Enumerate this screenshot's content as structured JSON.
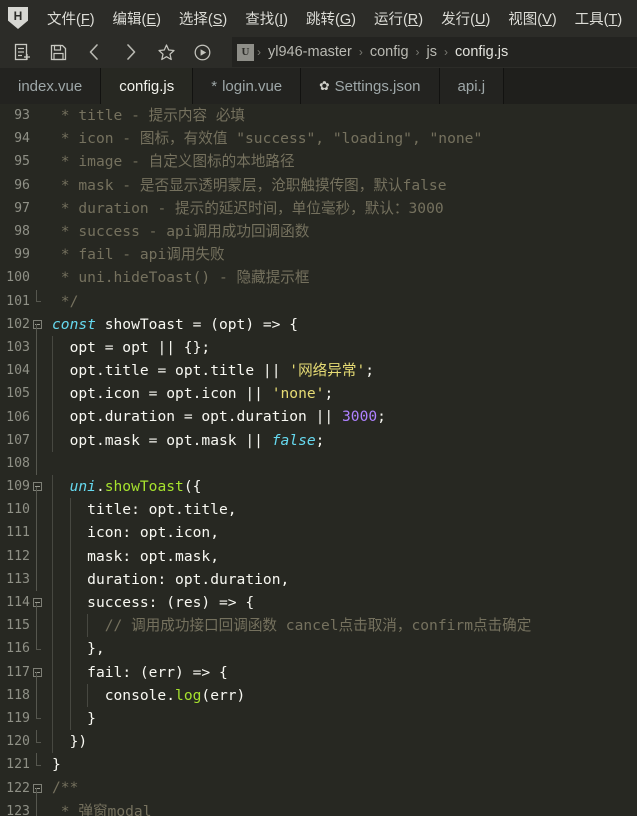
{
  "app": {
    "logo_letter": "H",
    "logo_name": "hbuilder-logo"
  },
  "menubar": {
    "items": [
      {
        "label": "文件(F)",
        "pre": "文件(",
        "key": "F",
        "post": ")"
      },
      {
        "label": "编辑(E)",
        "pre": "编辑(",
        "key": "E",
        "post": ")"
      },
      {
        "label": "选择(S)",
        "pre": "选择(",
        "key": "S",
        "post": ")"
      },
      {
        "label": "查找(I)",
        "pre": "查找(",
        "key": "I",
        "post": ")"
      },
      {
        "label": "跳转(G)",
        "pre": "跳转(",
        "key": "G",
        "post": ")"
      },
      {
        "label": "运行(R)",
        "pre": "运行(",
        "key": "R",
        "post": ")"
      },
      {
        "label": "发行(U)",
        "pre": "发行(",
        "key": "U",
        "post": ")"
      },
      {
        "label": "视图(V)",
        "pre": "视图(",
        "key": "V",
        "post": ")"
      },
      {
        "label": "工具(T)",
        "pre": "工具(",
        "key": "T",
        "post": ")"
      }
    ]
  },
  "toolbar": {
    "icons": [
      {
        "name": "new-file-icon"
      },
      {
        "name": "save-icon"
      },
      {
        "name": "back-arrow-icon"
      },
      {
        "name": "forward-arrow-icon"
      },
      {
        "name": "star-icon"
      },
      {
        "name": "run-icon"
      }
    ],
    "breadcrumb": {
      "project_badge": "U",
      "separator": "›",
      "items": [
        "yl946-master",
        "config",
        "js",
        "config.js"
      ]
    }
  },
  "tabs": [
    {
      "label": "index.vue",
      "active": false,
      "modified": false,
      "gear": false
    },
    {
      "label": "config.js",
      "active": true,
      "modified": false,
      "gear": false
    },
    {
      "label": "login.vue",
      "active": false,
      "modified": true,
      "gear": false,
      "modified_mark": "*"
    },
    {
      "label": "Settings.json",
      "active": false,
      "modified": false,
      "gear": true,
      "gear_glyph": "✿"
    },
    {
      "label": "api.j",
      "active": false,
      "modified": false,
      "gear": false
    }
  ],
  "editor": {
    "first_line": 93,
    "colors": {
      "background": "#272822",
      "foreground": "#f8f8f2",
      "comment": "#75715e",
      "keyword": "#66d9ef",
      "function": "#a6e22e",
      "string": "#e6db74",
      "number": "#ae81ff",
      "linenumber": "#8f9086"
    },
    "lines": [
      {
        "n": 93,
        "fold": "none",
        "guide": 0,
        "text": " * title - 提示内容 必填"
      },
      {
        "n": 94,
        "fold": "none",
        "guide": 0,
        "text": " * icon - 图标，有效值 \"success\", \"loading\", \"none\""
      },
      {
        "n": 95,
        "fold": "none",
        "guide": 0,
        "text": " * image - 自定义图标的本地路径"
      },
      {
        "n": 96,
        "fold": "none",
        "guide": 0,
        "text": " * mask - 是否显示透明蒙层，沧职触摸传图，默认false"
      },
      {
        "n": 97,
        "fold": "none",
        "guide": 0,
        "text": " * duration - 提示的延迟时间，单位毫秒，默认：3000"
      },
      {
        "n": 98,
        "fold": "none",
        "guide": 0,
        "text": " * success - api调用成功回调函数"
      },
      {
        "n": 99,
        "fold": "none",
        "guide": 0,
        "text": " * fail - api调用失败"
      },
      {
        "n": 100,
        "fold": "none",
        "guide": 0,
        "text": " * uni.hideToast() - 隐藏提示框"
      },
      {
        "n": 101,
        "fold": "end",
        "guide": 0,
        "text": " */"
      },
      {
        "n": 102,
        "fold": "start",
        "guide": 0,
        "text": "const showToast = (opt) => {"
      },
      {
        "n": 103,
        "fold": "mid",
        "guide": 1,
        "text": "  opt = opt || {};"
      },
      {
        "n": 104,
        "fold": "mid",
        "guide": 1,
        "text": "  opt.title = opt.title || '网络异常';"
      },
      {
        "n": 105,
        "fold": "mid",
        "guide": 1,
        "text": "  opt.icon = opt.icon || 'none';"
      },
      {
        "n": 106,
        "fold": "mid",
        "guide": 1,
        "text": "  opt.duration = opt.duration || 3000;"
      },
      {
        "n": 107,
        "fold": "mid",
        "guide": 1,
        "text": "  opt.mask = opt.mask || false;"
      },
      {
        "n": 108,
        "fold": "mid",
        "guide": 1,
        "text": ""
      },
      {
        "n": 109,
        "fold": "start2",
        "guide": 1,
        "text": "  uni.showToast({"
      },
      {
        "n": 110,
        "fold": "mid2",
        "guide": 2,
        "text": "    title: opt.title,"
      },
      {
        "n": 111,
        "fold": "mid2",
        "guide": 2,
        "text": "    icon: opt.icon,"
      },
      {
        "n": 112,
        "fold": "mid2",
        "guide": 2,
        "text": "    mask: opt.mask,"
      },
      {
        "n": 113,
        "fold": "mid2",
        "guide": 2,
        "text": "    duration: opt.duration,"
      },
      {
        "n": 114,
        "fold": "start3",
        "guide": 2,
        "text": "    success: (res) => {"
      },
      {
        "n": 115,
        "fold": "mid3",
        "guide": 3,
        "text": "      // 调用成功接口回调函数 cancel点击取消，confirm点击确定"
      },
      {
        "n": 116,
        "fold": "end3",
        "guide": 2,
        "text": "    },"
      },
      {
        "n": 117,
        "fold": "start3",
        "guide": 2,
        "text": "    fail: (err) => {"
      },
      {
        "n": 118,
        "fold": "mid3",
        "guide": 3,
        "text": "      console.log(err)"
      },
      {
        "n": 119,
        "fold": "end3",
        "guide": 2,
        "text": "    }"
      },
      {
        "n": 120,
        "fold": "end2",
        "guide": 1,
        "text": "  })"
      },
      {
        "n": 121,
        "fold": "end",
        "guide": 0,
        "text": "}"
      },
      {
        "n": 122,
        "fold": "start",
        "guide": 0,
        "text": "/**"
      },
      {
        "n": 123,
        "fold": "mid",
        "guide": 0,
        "text": " * 弹窗modal"
      }
    ]
  }
}
